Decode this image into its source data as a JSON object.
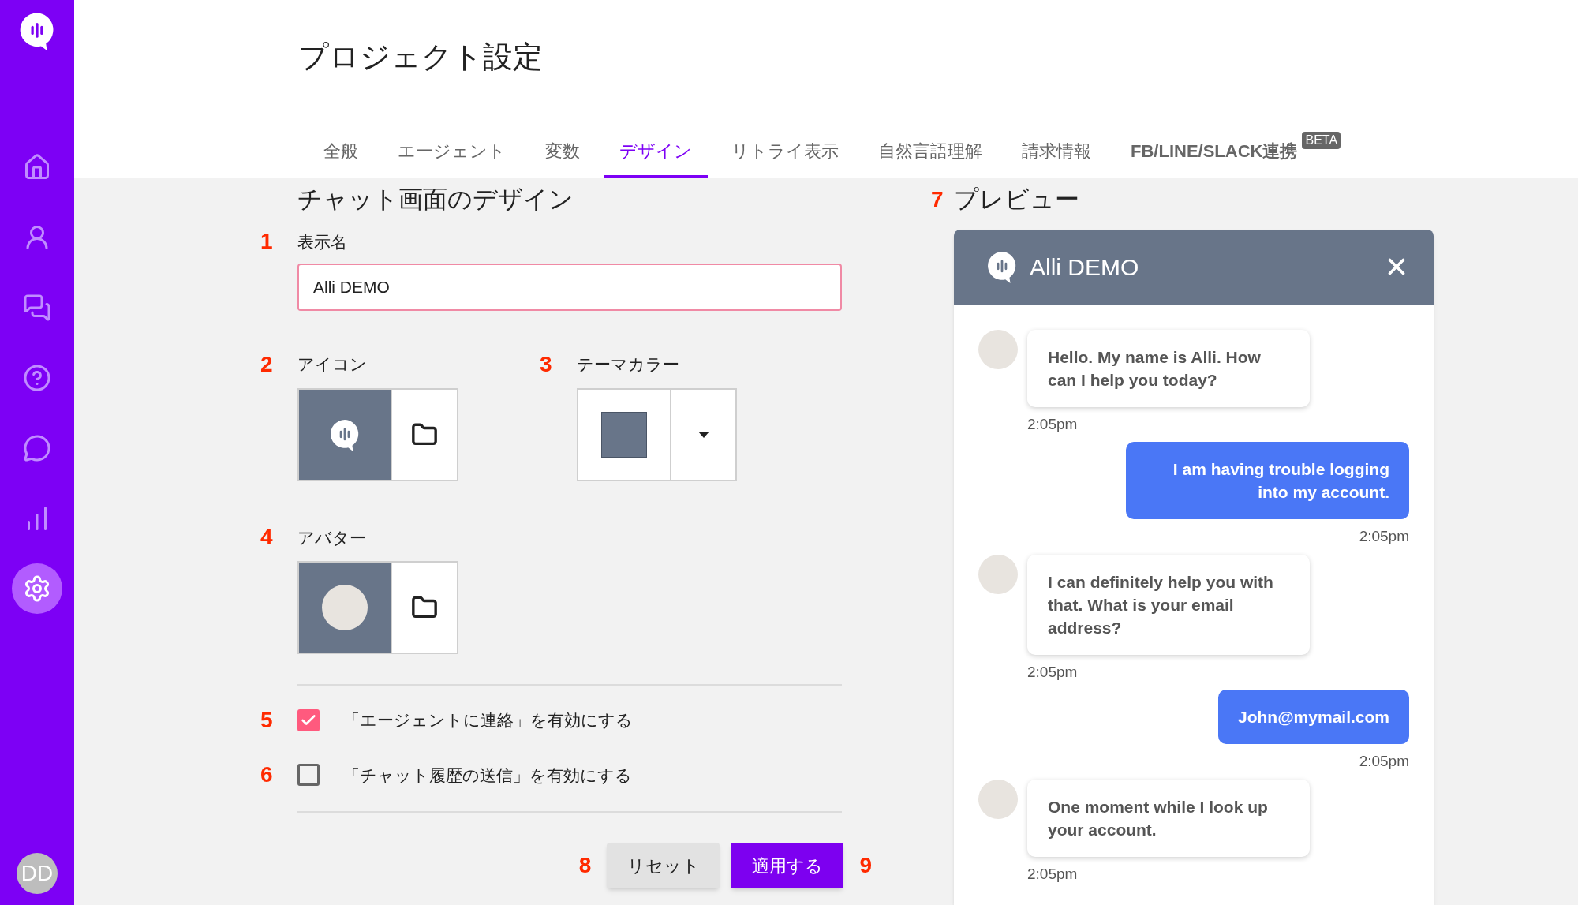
{
  "sidebar": {
    "items": [
      {
        "kind": "home",
        "selected": false
      },
      {
        "kind": "user",
        "selected": false
      },
      {
        "kind": "chats",
        "selected": false
      },
      {
        "kind": "help",
        "selected": false
      },
      {
        "kind": "smile",
        "selected": false
      },
      {
        "kind": "chart",
        "selected": false
      },
      {
        "kind": "settings",
        "selected": true
      }
    ],
    "user_initials": "DD"
  },
  "page_title": "プロジェクト設定",
  "tabs": [
    {
      "label": "全般",
      "selected": false
    },
    {
      "label": "エージェント",
      "selected": false
    },
    {
      "label": "変数",
      "selected": false
    },
    {
      "label": "デザイン",
      "selected": true
    },
    {
      "label": "リトライ表示",
      "selected": false
    },
    {
      "label": "自然言語理解",
      "selected": false
    },
    {
      "label": "請求情報",
      "selected": false
    },
    {
      "label": "FB/LINE/SLACK連携",
      "selected": false,
      "badge": "BETA"
    }
  ],
  "design": {
    "title": "チャット画面のデザイン",
    "display_name": {
      "number": "1",
      "label": "表示名",
      "value": "Alli DEMO"
    },
    "icon": {
      "number": "2",
      "label": "アイコン"
    },
    "theme_color": {
      "number": "3",
      "label": "テーマカラー",
      "color": "#687589"
    },
    "avatar": {
      "number": "4",
      "label": "アバター"
    },
    "options": [
      {
        "number": "5",
        "label": "「エージェントに連絡」を有効にする",
        "checked": true
      },
      {
        "number": "6",
        "label": "「チャット履歴の送信」を有効にする",
        "checked": false
      }
    ],
    "buttons": [
      {
        "number": "8",
        "label": "リセット",
        "kind": "secondary"
      },
      {
        "number": "9",
        "label": "適用する",
        "kind": "primary"
      }
    ]
  },
  "preview": {
    "number": "7",
    "title": "プレビュー",
    "chat_title": "Alli DEMO",
    "messages": [
      {
        "kind": "bot",
        "text": "Hello. My name is Alli. How can I help you today?",
        "time": "2:05pm"
      },
      {
        "kind": "user",
        "text": "I am having trouble logging into my account.",
        "time": "2:05pm"
      },
      {
        "kind": "bot",
        "text": "I can definitely help you with that. What is your email address?",
        "time": "2:05pm"
      },
      {
        "kind": "user",
        "text": "John@mymail.com",
        "time": "2:05pm"
      },
      {
        "kind": "bot",
        "text": "One moment while I look up your account.",
        "time": "2:05pm"
      }
    ]
  }
}
